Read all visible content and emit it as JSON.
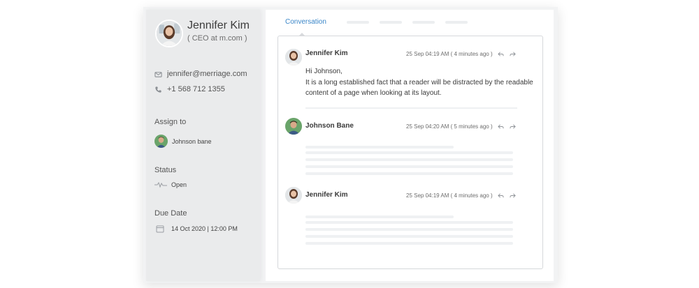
{
  "profile": {
    "name": "Jennifer Kim",
    "title": "( CEO at m.com )",
    "email": "jennifer@merriage.com",
    "phone": "+1 568 712 1355"
  },
  "assign": {
    "label": "Assign to",
    "assignee": "Johnson bane"
  },
  "status": {
    "label": "Status",
    "value": "Open"
  },
  "due": {
    "label": "Due Date",
    "value": "14 Oct 2020 | 12:00 PM"
  },
  "tabs": {
    "active": "Conversation"
  },
  "messages": [
    {
      "author": "Jennifer Kim",
      "meta": "25 Sep 04:19 AM ( 4 minutes ago )",
      "lines": [
        "Hi Johnson,",
        "It is a long established fact that a reader will be distracted by the readable",
        "content of a page when looking at its layout."
      ]
    },
    {
      "author": "Johnson Bane",
      "meta": "25 Sep 04:20 AM ( 5 minutes ago )"
    },
    {
      "author": "Jennifer Kim",
      "meta": "25 Sep 04:19 AM ( 4 minutes ago )"
    }
  ],
  "icons": {
    "email": "mail-icon",
    "phone": "phone-icon",
    "status": "activity-icon",
    "due": "calendar-icon",
    "reply": "reply-icon",
    "forward": "forward-icon"
  },
  "colors": {
    "accent": "#3a86c8",
    "sidebar_bg": "#eaebec",
    "border": "#d6d8db"
  }
}
